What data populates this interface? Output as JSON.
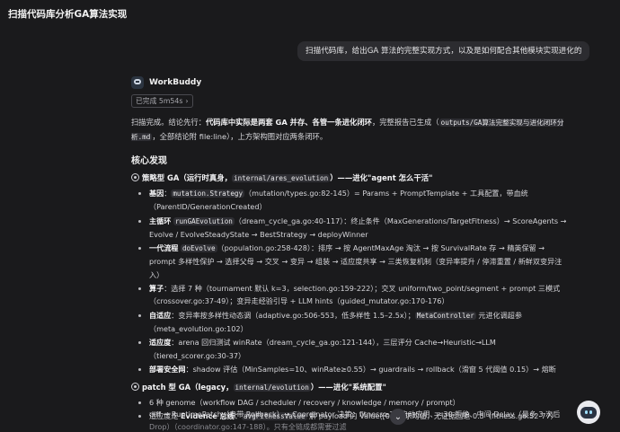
{
  "header": {
    "title": "扫描代码库分析GA算法实现"
  },
  "user_message": "扫描代码库，给出GA 算法的完整实现方式，以及是如何配合其他模块实现进化的",
  "agent": {
    "name": "WorkBuddy",
    "status_label": "已完成 5m54s",
    "summary_parts": {
      "p1": "扫描完成。结论先行：",
      "bold": "代码库中实际是两套 GA 并存、各管一条进化闭环",
      "p2": "，完整报告已生成（",
      "code": "outputs/GA算法完整实现与进化闭环分析.md",
      "p3": "，全部结论附 file:line），上方架构图对应两条闭环。"
    },
    "section_heading": "核心发现",
    "section1": {
      "prefix": "策略型 GA（运行时真身，",
      "code": "internal/ares_evolution",
      "suffix": "）——进化\"agent 怎么干活\"",
      "items": [
        {
          "label": "基因",
          "text": "：",
          "code": "mutation.Strategy",
          "rest": "（mutation/types.go:82-145）= Params + PromptTemplate + 工具配置，带血统（ParentID/GenerationCreated）"
        },
        {
          "label": "主循环",
          "text": " ",
          "code": "runGAEvolution",
          "rest": "（dream_cycle_ga.go:40-117）：终止条件（MaxGenerations/TargetFitness）→ ScoreAgents → Evolve / EvolveSteadyState → BestStrategy → deployWinner"
        },
        {
          "label": "一代流程",
          "text": " ",
          "code": "doEvolve",
          "rest": "（population.go:258-428）：排序 → 按 AgentMaxAge 淘汰 → 按 SurvivalRate 存 → 精英保留 → prompt 多样性保护 → 选择父母 → 交叉 → 变异 → 组装 → 适应度共享 → 三类恢复机制（变异率提升 / 停滞重置 / 新鲜双变异注入）"
        },
        {
          "label": "算子",
          "text": "：选择 7 种（tournament 默认 k=3，selection.go:159-222）；交叉 uniform/two_point/segment + prompt 三模式（crossover.go:37-49）；变异走经验引导 + LLM hints（guided_mutator.go:170-176）",
          "code": "",
          "rest": ""
        },
        {
          "label": "自适应",
          "text": "：变异率按多样性动态调（adaptive.go:506-553，低多样性 1.5–2.5x）；",
          "code": "MetaController",
          "rest": " 元进化调超参（meta_evolution.go:102）"
        },
        {
          "label": "适应度",
          "text": "：arena 回归测试 winRate（dream_cycle_ga.go:121-144），三层评分 Cache→Heuristic→LLM（tiered_scorer.go:30-37）",
          "code": "",
          "rest": ""
        },
        {
          "label": "部署安全网",
          "text": "：shadow 评估（MinSamples=10、winRate≥0.55）→ guardrails → rollback（滑窗 5 代阈值 0.15）→ 熔断",
          "code": "",
          "rest": ""
        }
      ]
    },
    "section2": {
      "prefix": "patch 型 GA（legacy，",
      "code": "internal/evolution",
      "suffix": "）——进化\"系统配置\"",
      "items": [
        {
          "label": "",
          "text": "6 种 genome（workflow DAG / scheduler / recovery / knowledge / memory / prompt）",
          "code": "",
          "rest": ""
        },
        {
          "label": "",
          "text": "适应度走 ",
          "bold": "Evidence 总线",
          "text2": "：",
          "code": "avgFitnessValue",
          "rest": " 解 payload 的 Value([0,1]) 求均值，无证据回退 0.5（fitness.go:52-77）"
        },
        {
          "label": "",
          "text": "diff → ",
          "code": "RuntimePatch",
          "rest": "（自带 Rollback）→ Coordinator 决策：fitness≥70 自动应用、<30 拒绝、中间 Delay（最多 3 次后 Drop）（coordinator.go:147-188）。只有全链成都需要过滤"
        }
      ]
    },
    "bottom_line1": "diff → RuntimePatch（自带 Rollback）→ Coordinator 决策：fitness≥70 自动应用、<30 拒绝、中间 Delay（最多 3 次后",
    "bottom_line2": "Drop）（coordinator.go:147-188）。只有全链成都需要过滤"
  },
  "colors": {
    "background": "#1a1a1c",
    "bubble": "#2c2c30",
    "code_bg": "#2e2e33"
  },
  "icons": {
    "avatar": "robot-avatar-icon",
    "chevron": "chevron-right-icon",
    "scroll": "chevron-down-icon",
    "mascot": "mascot-icon"
  }
}
